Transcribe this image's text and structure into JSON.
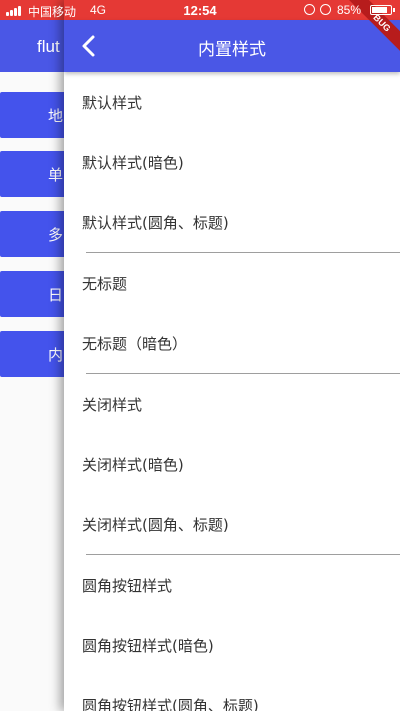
{
  "status_bar": {
    "carrier": "中国移动",
    "network": "4G",
    "time": "12:54",
    "battery": "85%",
    "battery_level": 0.85
  },
  "background_page": {
    "title": "flut",
    "buttons": [
      "地",
      "单",
      "多",
      "日",
      "内"
    ]
  },
  "app_bar": {
    "title": "内置样式",
    "back_icon": "chevron-left-icon"
  },
  "list": {
    "items": [
      {
        "label": "默认样式"
      },
      {
        "label": "默认样式(暗色)"
      },
      {
        "label": "默认样式(圆角、标题)"
      },
      {
        "label": "无标题"
      },
      {
        "label": "无标题（暗色）"
      },
      {
        "label": "关闭样式"
      },
      {
        "label": "关闭样式(暗色)"
      },
      {
        "label": "关闭样式(圆角、标题)"
      },
      {
        "label": "圆角按钮样式"
      },
      {
        "label": "圆角按钮样式(暗色)"
      },
      {
        "label": "圆角按钮样式(圆角、标题)"
      }
    ]
  },
  "debug_banner": "BUG",
  "colors": {
    "status_bar": "#e53935",
    "app_bar": "#4a57e6",
    "button": "#4453ec",
    "debug_banner": "#b71c1c"
  }
}
